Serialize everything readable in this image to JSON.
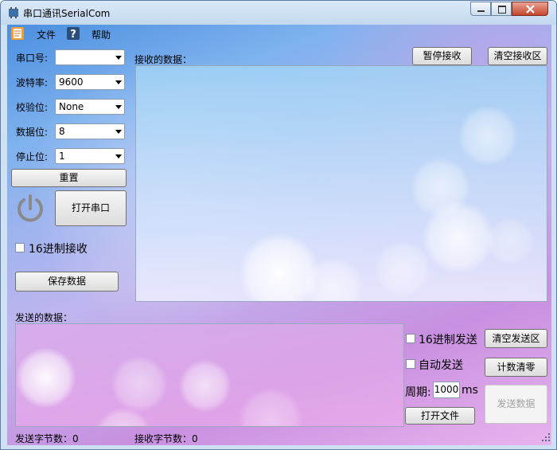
{
  "window": {
    "title": "串口通讯SerialCom"
  },
  "menu": {
    "items": [
      "文件",
      "帮助"
    ]
  },
  "settings": {
    "port_label": "串口号:",
    "port_value": "",
    "baud_label": "波特率:",
    "baud_value": "9600",
    "parity_label": "校验位:",
    "parity_value": "None",
    "databits_label": "数据位:",
    "databits_value": "8",
    "stopbits_label": "停止位:",
    "stopbits_value": "1",
    "reset_button": "重置",
    "open_port_button": "打开串口",
    "hex_receive_label": "16进制接收",
    "save_data_button": "保存数据"
  },
  "receive": {
    "label": "接收的数据：",
    "pause_button": "暂停接收",
    "clear_button": "清空接收区"
  },
  "send": {
    "label": "发送的数据：",
    "hex_send_label": "16进制发送",
    "clear_button": "清空发送区",
    "auto_send_label": "自动发送",
    "reset_count_button": "计数清零",
    "period_label": "周期:",
    "period_value": "1000",
    "period_unit": "ms",
    "send_button": "发送数据",
    "open_file_button": "打开文件"
  },
  "status": {
    "sent_label": "发送字节数：",
    "sent_value": "0",
    "recv_label": "接收字节数：",
    "recv_value": "0"
  }
}
